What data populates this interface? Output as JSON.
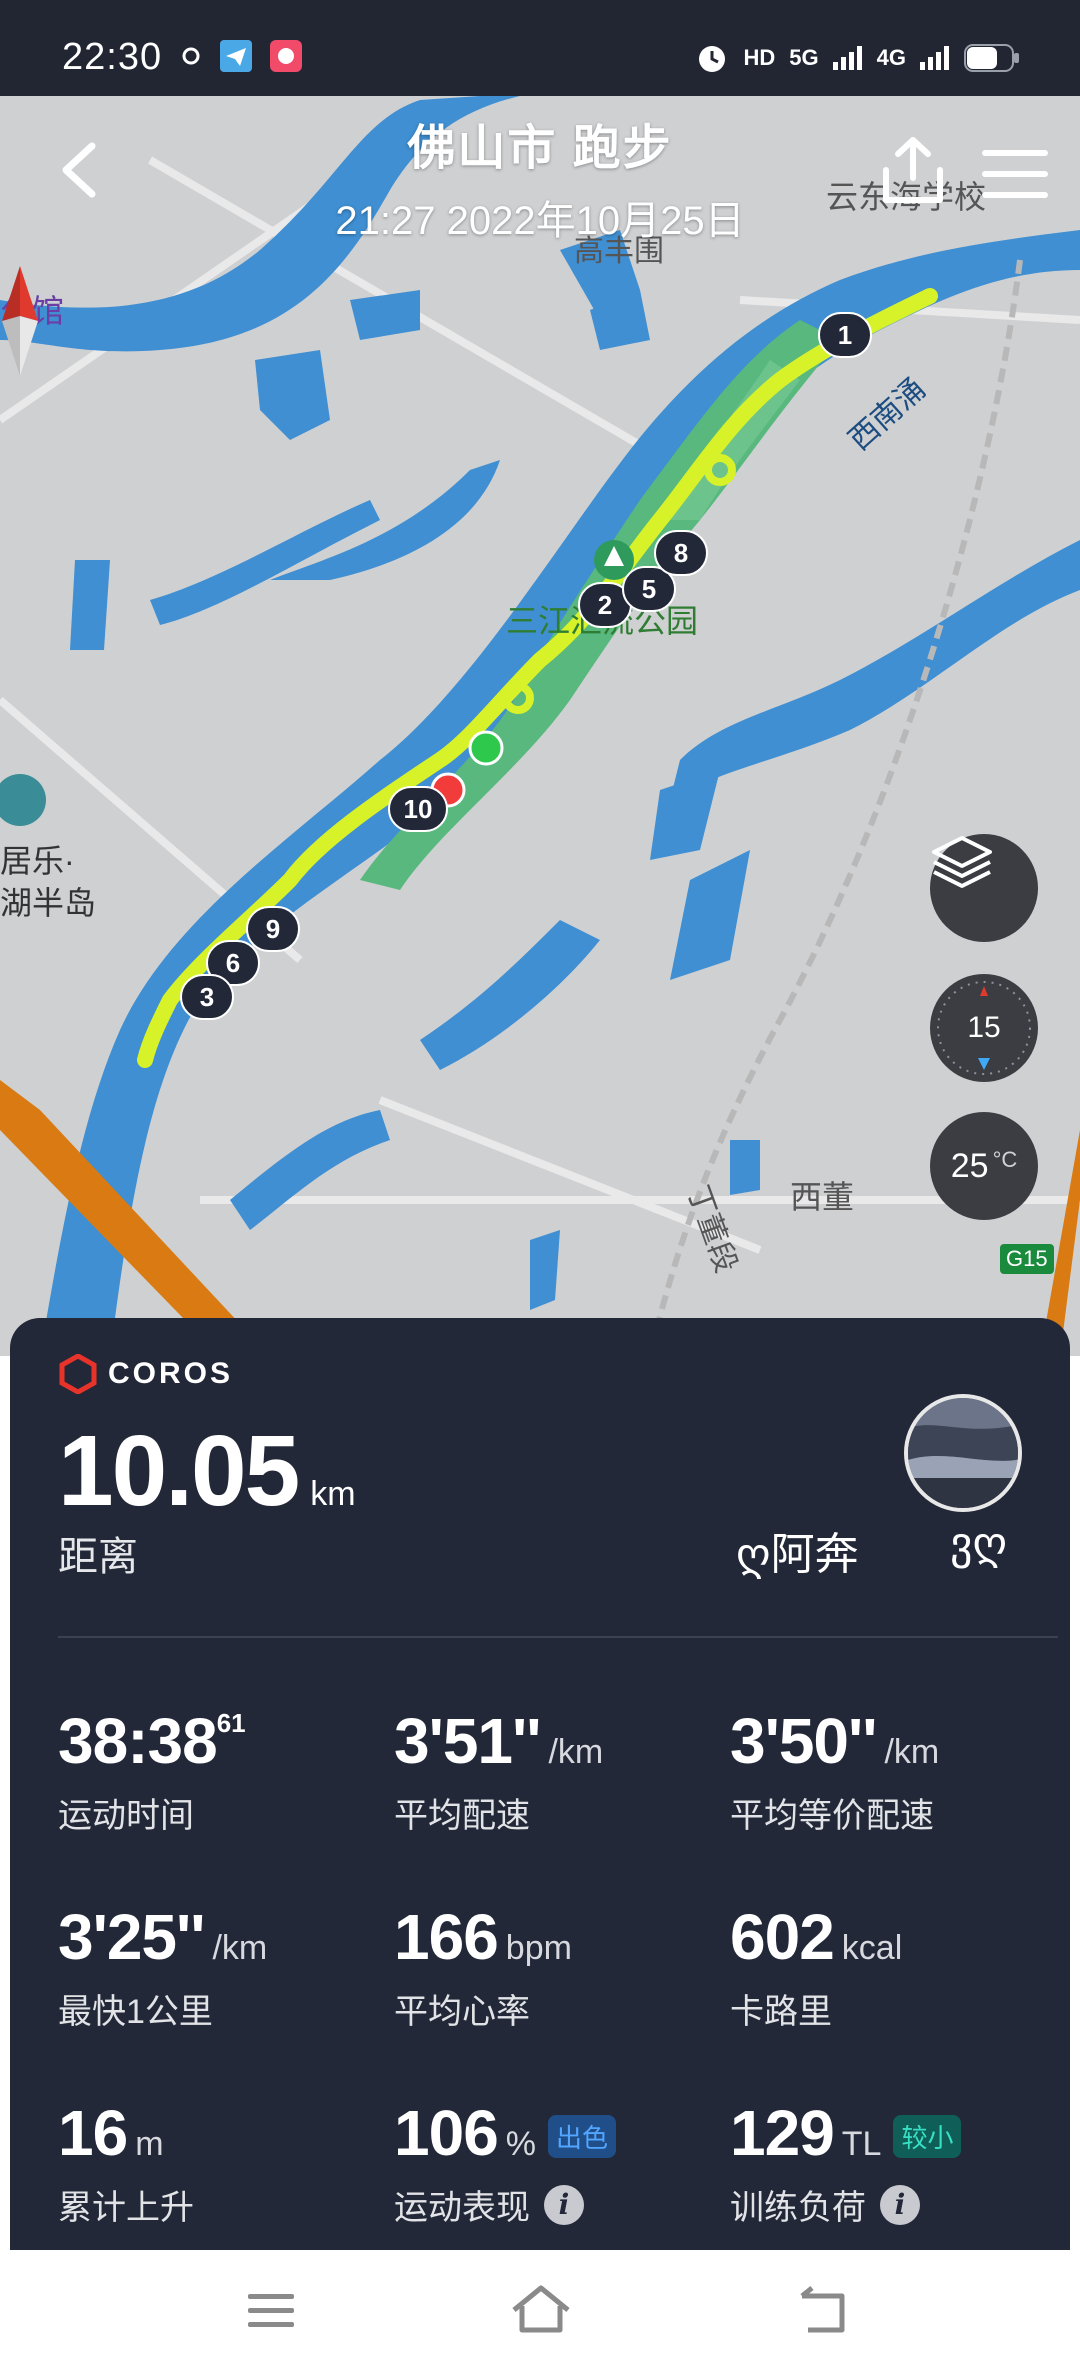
{
  "status_bar": {
    "time": "22:30",
    "icons_left": [
      "sync-icon",
      "telegram-icon",
      "app-notification-icon"
    ],
    "icons_right": [
      "alarm-icon",
      "hd-icon",
      "5g-signal-icon",
      "4g-signal-icon",
      "battery-icon"
    ],
    "hd_label": "HD",
    "g5_label": "5G",
    "g4_label": "4G"
  },
  "header": {
    "title": "佛山市 跑步",
    "subtitle": "21:27 2022年10月25日"
  },
  "map": {
    "labels": {
      "school": "云东海学校",
      "village": "高丰围",
      "river": "西南涌",
      "park": "三江汇流公园",
      "left_poi": "公馆",
      "lake_island_1": "居乐·",
      "lake_island_2": "湖半岛",
      "xidong": "西董",
      "road": "丁董段",
      "highway": "G15"
    },
    "markers": [
      "1",
      "2",
      "5",
      "8",
      "10",
      "9",
      "6",
      "3"
    ],
    "compass_value": "15",
    "compass_n": "N",
    "temperature": "25",
    "temperature_unit": "°C",
    "route_color": "#d8f22a",
    "water_color": "#3f8fd2"
  },
  "card": {
    "brand": "COROS",
    "distance": "10.05",
    "distance_unit": "km",
    "distance_label": "距离",
    "username": "ღ阿奔",
    "username_suffix": "ვღ",
    "metrics": [
      {
        "value": "38:38",
        "sup": "61",
        "unit": "",
        "label": "运动时间"
      },
      {
        "value": "3'51''",
        "sup": "",
        "unit": "/km",
        "label": "平均配速"
      },
      {
        "value": "3'50''",
        "sup": "",
        "unit": "/km",
        "label": "平均等价配速"
      },
      {
        "value": "3'25''",
        "sup": "",
        "unit": "/km",
        "label": "最快1公里"
      },
      {
        "value": "166",
        "sup": "",
        "unit": "bpm",
        "label": "平均心率"
      },
      {
        "value": "602",
        "sup": "",
        "unit": "kcal",
        "label": "卡路里"
      },
      {
        "value": "16",
        "sup": "",
        "unit": "m",
        "label": "累计上升"
      },
      {
        "value": "106",
        "sup": "",
        "unit": "%",
        "label": "运动表现",
        "badge": "出色"
      },
      {
        "value": "129",
        "sup": "",
        "unit": "TL",
        "label": "训练负荷",
        "badge": "较小"
      }
    ]
  }
}
